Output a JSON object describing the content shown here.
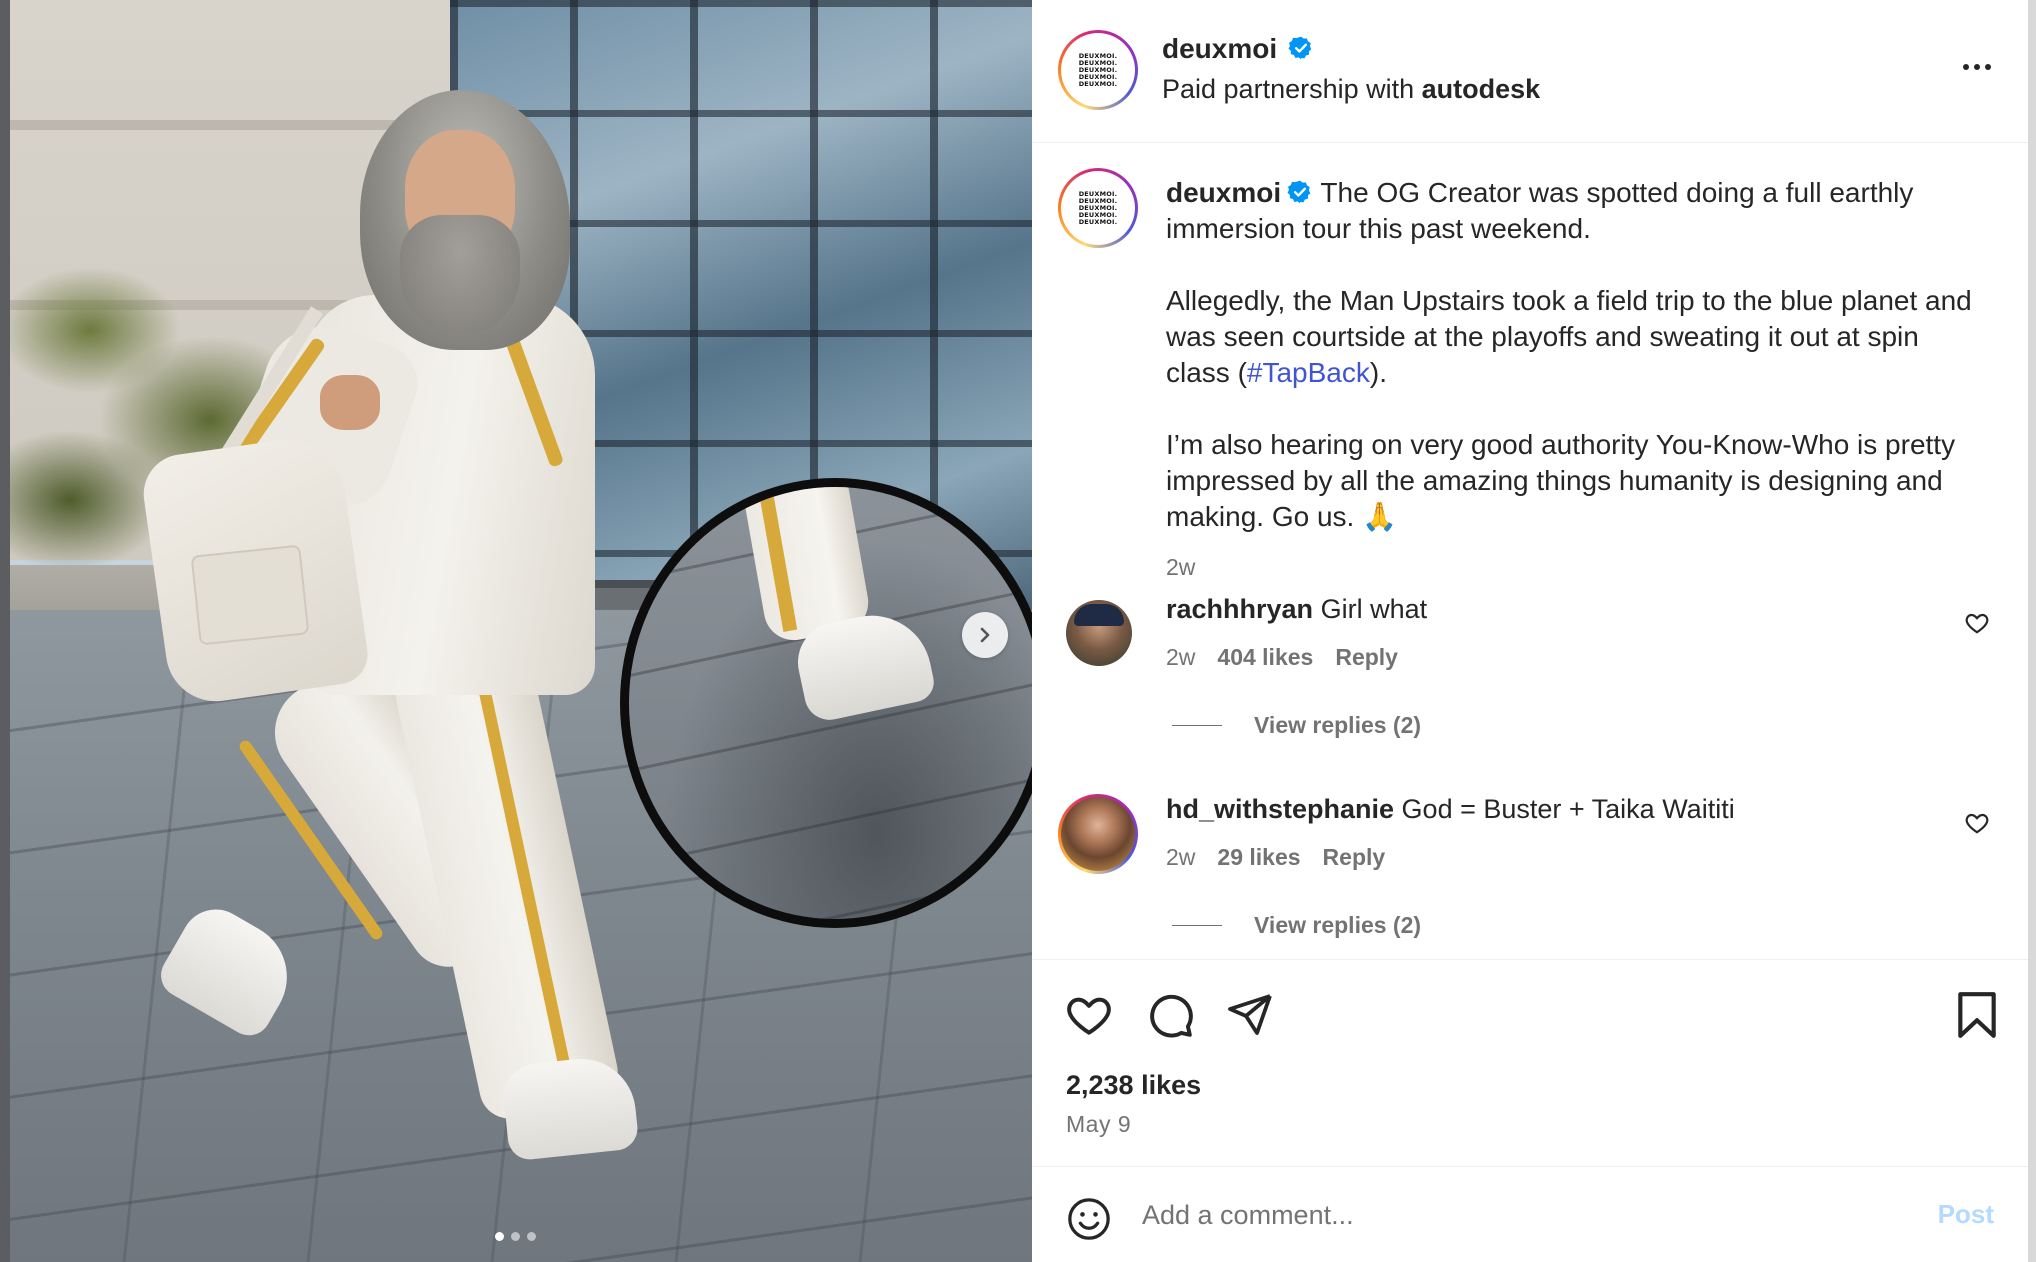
{
  "media": {
    "carousel_count": 3,
    "active_index": 0,
    "next_icon": "chevron-right-icon"
  },
  "header": {
    "username": "deuxmoi",
    "verified": true,
    "partnership_prefix": "Paid partnership with ",
    "partner": "autodesk",
    "avatar_text": "DEUXMOI.",
    "more_icon": "more-horizontal-icon"
  },
  "caption": {
    "username": "deuxmoi",
    "verified": true,
    "para1": "The OG Creator was spotted doing a full earthly immersion tour this past weekend.",
    "para2_before": "Allegedly, the Man Upstairs took a field trip to the blue planet and was seen courtside at the playoffs and sweating it out at spin class (",
    "hashtag": "#TapBack",
    "para2_after": ").",
    "para3": "I’m also hearing on very good authority You-Know-Who is pretty impressed by all the amazing things humanity is designing and making. Go us. 🙏",
    "time": "2w"
  },
  "comments": [
    {
      "username": "rachhhryan",
      "text": "Girl what",
      "time": "2w",
      "likes": "404 likes",
      "reply_label": "Reply",
      "view_replies": "View replies (2)"
    },
    {
      "username": "hd_withstephanie",
      "text": "God = Buster + Taika Waititi",
      "time": "2w",
      "likes": "29 likes",
      "reply_label": "Reply",
      "view_replies": "View replies (2)"
    }
  ],
  "actions": {
    "like_icon": "heart-icon",
    "comment_icon": "comment-bubble-icon",
    "share_icon": "paper-plane-icon",
    "save_icon": "bookmark-icon",
    "likes_count": "2,238 likes",
    "date": "May 9"
  },
  "add_comment": {
    "placeholder": "Add a comment...",
    "post_label": "Post",
    "emoji_icon": "smiley-icon"
  },
  "colors": {
    "verified_blue": "#0095f6",
    "hashtag": "#4154d1",
    "post_disabled": "#b3dbff",
    "muted_text": "#737373"
  }
}
